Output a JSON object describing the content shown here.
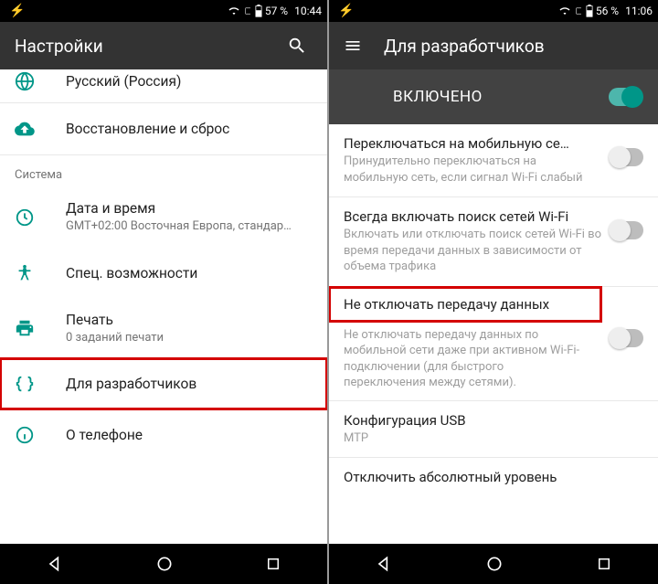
{
  "left": {
    "status": {
      "battery": "57 %",
      "time": "10:44"
    },
    "appbar": {
      "title": "Настройки"
    },
    "lang_row": {
      "title": "Русский (Россия)"
    },
    "backup_row": {
      "title": "Восстановление и сброс"
    },
    "subheader": "Система",
    "date_row": {
      "title": "Дата и время",
      "subtitle": "GMT+02:00 Восточная Европа, стандар…"
    },
    "access_row": {
      "title": "Спец. возможности"
    },
    "print_row": {
      "title": "Печать",
      "subtitle": "0 заданий печати"
    },
    "dev_row": {
      "title": "Для разработчиков"
    },
    "about_row": {
      "title": "О телефоне"
    }
  },
  "right": {
    "status": {
      "battery": "56 %",
      "time": "11:06"
    },
    "appbar": {
      "title": "Для разработчиков"
    },
    "enabled_label": "ВКЛЮЧЕНО",
    "r1": {
      "title": "Переключаться на мобильную се…",
      "subtitle": "Принудительно переключаться на мобильную сеть, если сигнал Wi-Fi слабый"
    },
    "r2": {
      "title": "Всегда включать поиск сетей Wi-Fi",
      "subtitle": "Включать или отключать поиск сетей Wi-Fi во время передачи данных в зависимости от объема трафика"
    },
    "r3": {
      "title": "Не отключать передачу данных",
      "subtitle": "Не отключать передачу данных по мобильной сети даже при активном Wi-Fi-подключении (для быстрого переключения между сетями)."
    },
    "r4": {
      "title": "Конфигурация USB",
      "subtitle": "MTP"
    },
    "r5": {
      "title": "Отключить абсолютный уровень"
    }
  }
}
